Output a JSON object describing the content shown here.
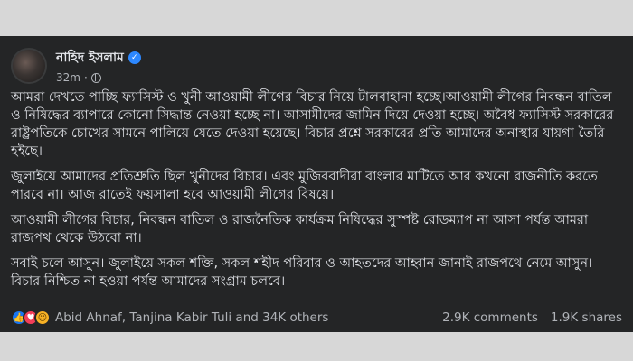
{
  "post": {
    "author": "নাহিদ ইসলাম",
    "time": "32m",
    "paragraphs": [
      "আমরা দেখতে পাচ্ছি ফ্যাসিস্ট ও খুনী আওয়ামী লীগের বিচার নিয়ে টালবাহানা হচ্ছে।আওয়ামী লীগের নিবন্ধন বাতিল ও নিষিদ্ধের ব্যাপারে কোনো সিদ্ধান্ত নেওয়া হচ্ছে না। আসামীদের জামিন দিয়ে দেওয়া হচ্ছে। অবৈধ ফ্যাসিস্ট সরকারের রাষ্ট্রপতিকে চোখের সামনে পালিয়ে যেতে দেওয়া হয়েছে। বিচার প্রশ্নে সরকারের প্রতি আমাদের অনাস্থার যায়গা তৈরি হইছে।",
      "জুলাইয়ে আমাদের প্রতিশ্রুতি ছিল খুনীদের বিচার। এবং মুজিববাদীরা বাংলার মাটিতে আর কখনো রাজনীতি করতে পারবে না। আজ রাতেই ফয়সালা হবে আওয়ামী লীগের বিষয়ে।",
      "আওয়ামী লীগের বিচার, নিবন্ধন বাতিল ও রাজনৈতিক কার্যক্রম নিষিদ্ধের সুস্পষ্ট রোডম্যাপ না আসা পর্যন্ত আমরা রাজপথ থেকে উঠবো না।",
      "সবাই চলে আসুন। জুলাইয়ে সকল শক্তি, সকল শহীদ পরিবার ও আহতদের আহ্বান জানাই রাজপথে নেমে আসুন। বিচার নিশ্চিত না হওয়া পর্যন্ত আমাদের সংগ্রাম চলবে।"
    ],
    "reactions_summary": "Abid Ahnaf, Tanjina Kabir Tuli and 34K others",
    "comments": "2.9K comments",
    "shares": "1.9K shares",
    "reaction_icons": [
      "like-icon",
      "love-icon",
      "care-icon"
    ],
    "colors": {
      "background": "#242526",
      "text": "#e4e6eb",
      "muted": "#b0b3b8",
      "verified": "#2d88ff"
    }
  }
}
